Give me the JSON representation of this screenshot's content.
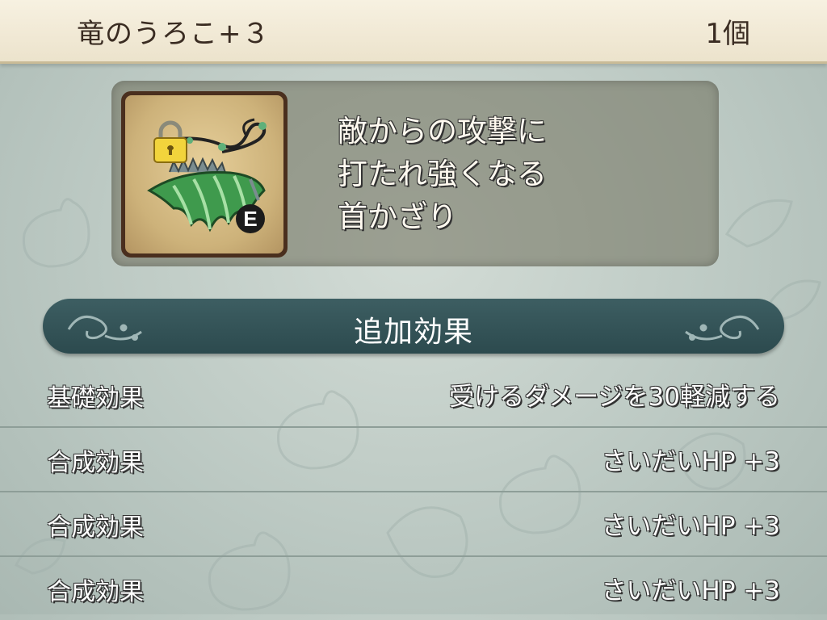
{
  "item": {
    "name": "竜のうろこ+３",
    "count": "1個",
    "description": "敵からの攻撃に\n打たれ強くなる\n首かざり",
    "equipped_badge": "E",
    "icon": "scale-necklace-icon",
    "lock_icon": "lock-icon"
  },
  "effects": {
    "section_title": "追加効果",
    "rows": [
      {
        "label": "基礎効果",
        "value": "受けるダメージを30軽減する"
      },
      {
        "label": "合成効果",
        "value": "さいだいHP +3"
      },
      {
        "label": "合成効果",
        "value": "さいだいHP +3"
      },
      {
        "label": "合成効果",
        "value": "さいだいHP +3"
      }
    ]
  },
  "colors": {
    "header_bg": "#f1e9d4",
    "section_bar": "#34555a",
    "icon_frame": "#4a2f1e"
  }
}
